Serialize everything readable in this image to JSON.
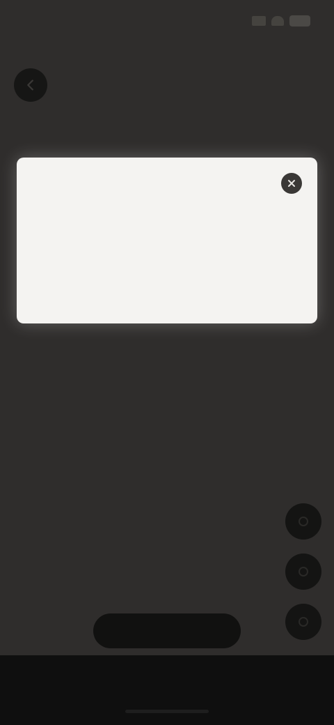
{
  "status_bar": {
    "time": ""
  },
  "promo": {
    "eyebrow": "",
    "title": "",
    "subtitle": "",
    "description": ""
  },
  "body": {
    "lines": [
      "",
      "",
      "",
      "",
      "",
      "",
      "",
      "",
      ""
    ]
  },
  "cta": {
    "label": ""
  },
  "icons": {
    "back": "arrow-left-icon",
    "close": "close-icon",
    "side_actions": [
      "action-icon",
      "action-icon",
      "action-icon"
    ]
  },
  "colors": {
    "background": "#2f2d2c",
    "card": "#f4f3f1",
    "button": "#141413",
    "bottom_bar": "#0f0f0f"
  }
}
